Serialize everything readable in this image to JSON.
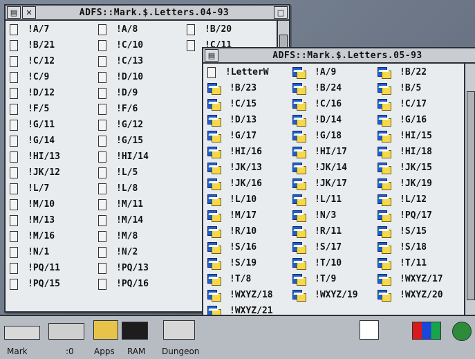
{
  "window_back": {
    "title": "ADFS::Mark.$.Letters.04-93",
    "items": [
      "!A/7",
      "!A/8",
      "!B/20",
      "!B/21",
      "!C/10",
      "!C/11",
      "!C/12",
      "!C/13",
      "",
      "!C/9",
      "!D/10",
      "",
      "!D/12",
      "!D/9",
      "",
      "!F/5",
      "!F/6",
      "",
      "!G/11",
      "!G/12",
      "",
      "!G/14",
      "!G/15",
      "",
      "!HI/13",
      "!HI/14",
      "",
      "!JK/12",
      "!L/5",
      "",
      "!L/7",
      "!L/8",
      "",
      "!M/10",
      "!M/11",
      "",
      "!M/13",
      "!M/14",
      "",
      "!M/16",
      "!M/8",
      "",
      "!N/1",
      "!N/2",
      "",
      "!PQ/11",
      "!PQ/13",
      "",
      "!PQ/15",
      "!PQ/16",
      ""
    ]
  },
  "window_front": {
    "title": "ADFS::Mark.$.Letters.05-93",
    "items": [
      "!LetterW",
      "!A/9",
      "!B/22",
      "!B/23",
      "!B/24",
      "!B/5",
      "!C/15",
      "!C/16",
      "!C/17",
      "!D/13",
      "!D/14",
      "!G/16",
      "!G/17",
      "!G/18",
      "!HI/15",
      "!HI/16",
      "!HI/17",
      "!HI/18",
      "!JK/13",
      "!JK/14",
      "!JK/15",
      "!JK/16",
      "!JK/17",
      "!JK/19",
      "!L/10",
      "!L/11",
      "!L/12",
      "!M/17",
      "!N/3",
      "!PQ/17",
      "!R/10",
      "!R/11",
      "!S/15",
      "!S/16",
      "!S/17",
      "!S/18",
      "!S/19",
      "!T/10",
      "!T/11",
      "!T/8",
      "!T/9",
      "!WXYZ/17",
      "!WXYZ/18",
      "!WXYZ/19",
      "!WXYZ/20",
      "!WXYZ/21",
      "",
      ""
    ]
  },
  "iconbar": {
    "items": [
      "Mark",
      ":0",
      "Apps",
      "RAM",
      "Dungeon"
    ]
  },
  "colors": {
    "file_icon_blue": "#1a5fd1",
    "file_icon_yellow": "#f5d94a"
  }
}
